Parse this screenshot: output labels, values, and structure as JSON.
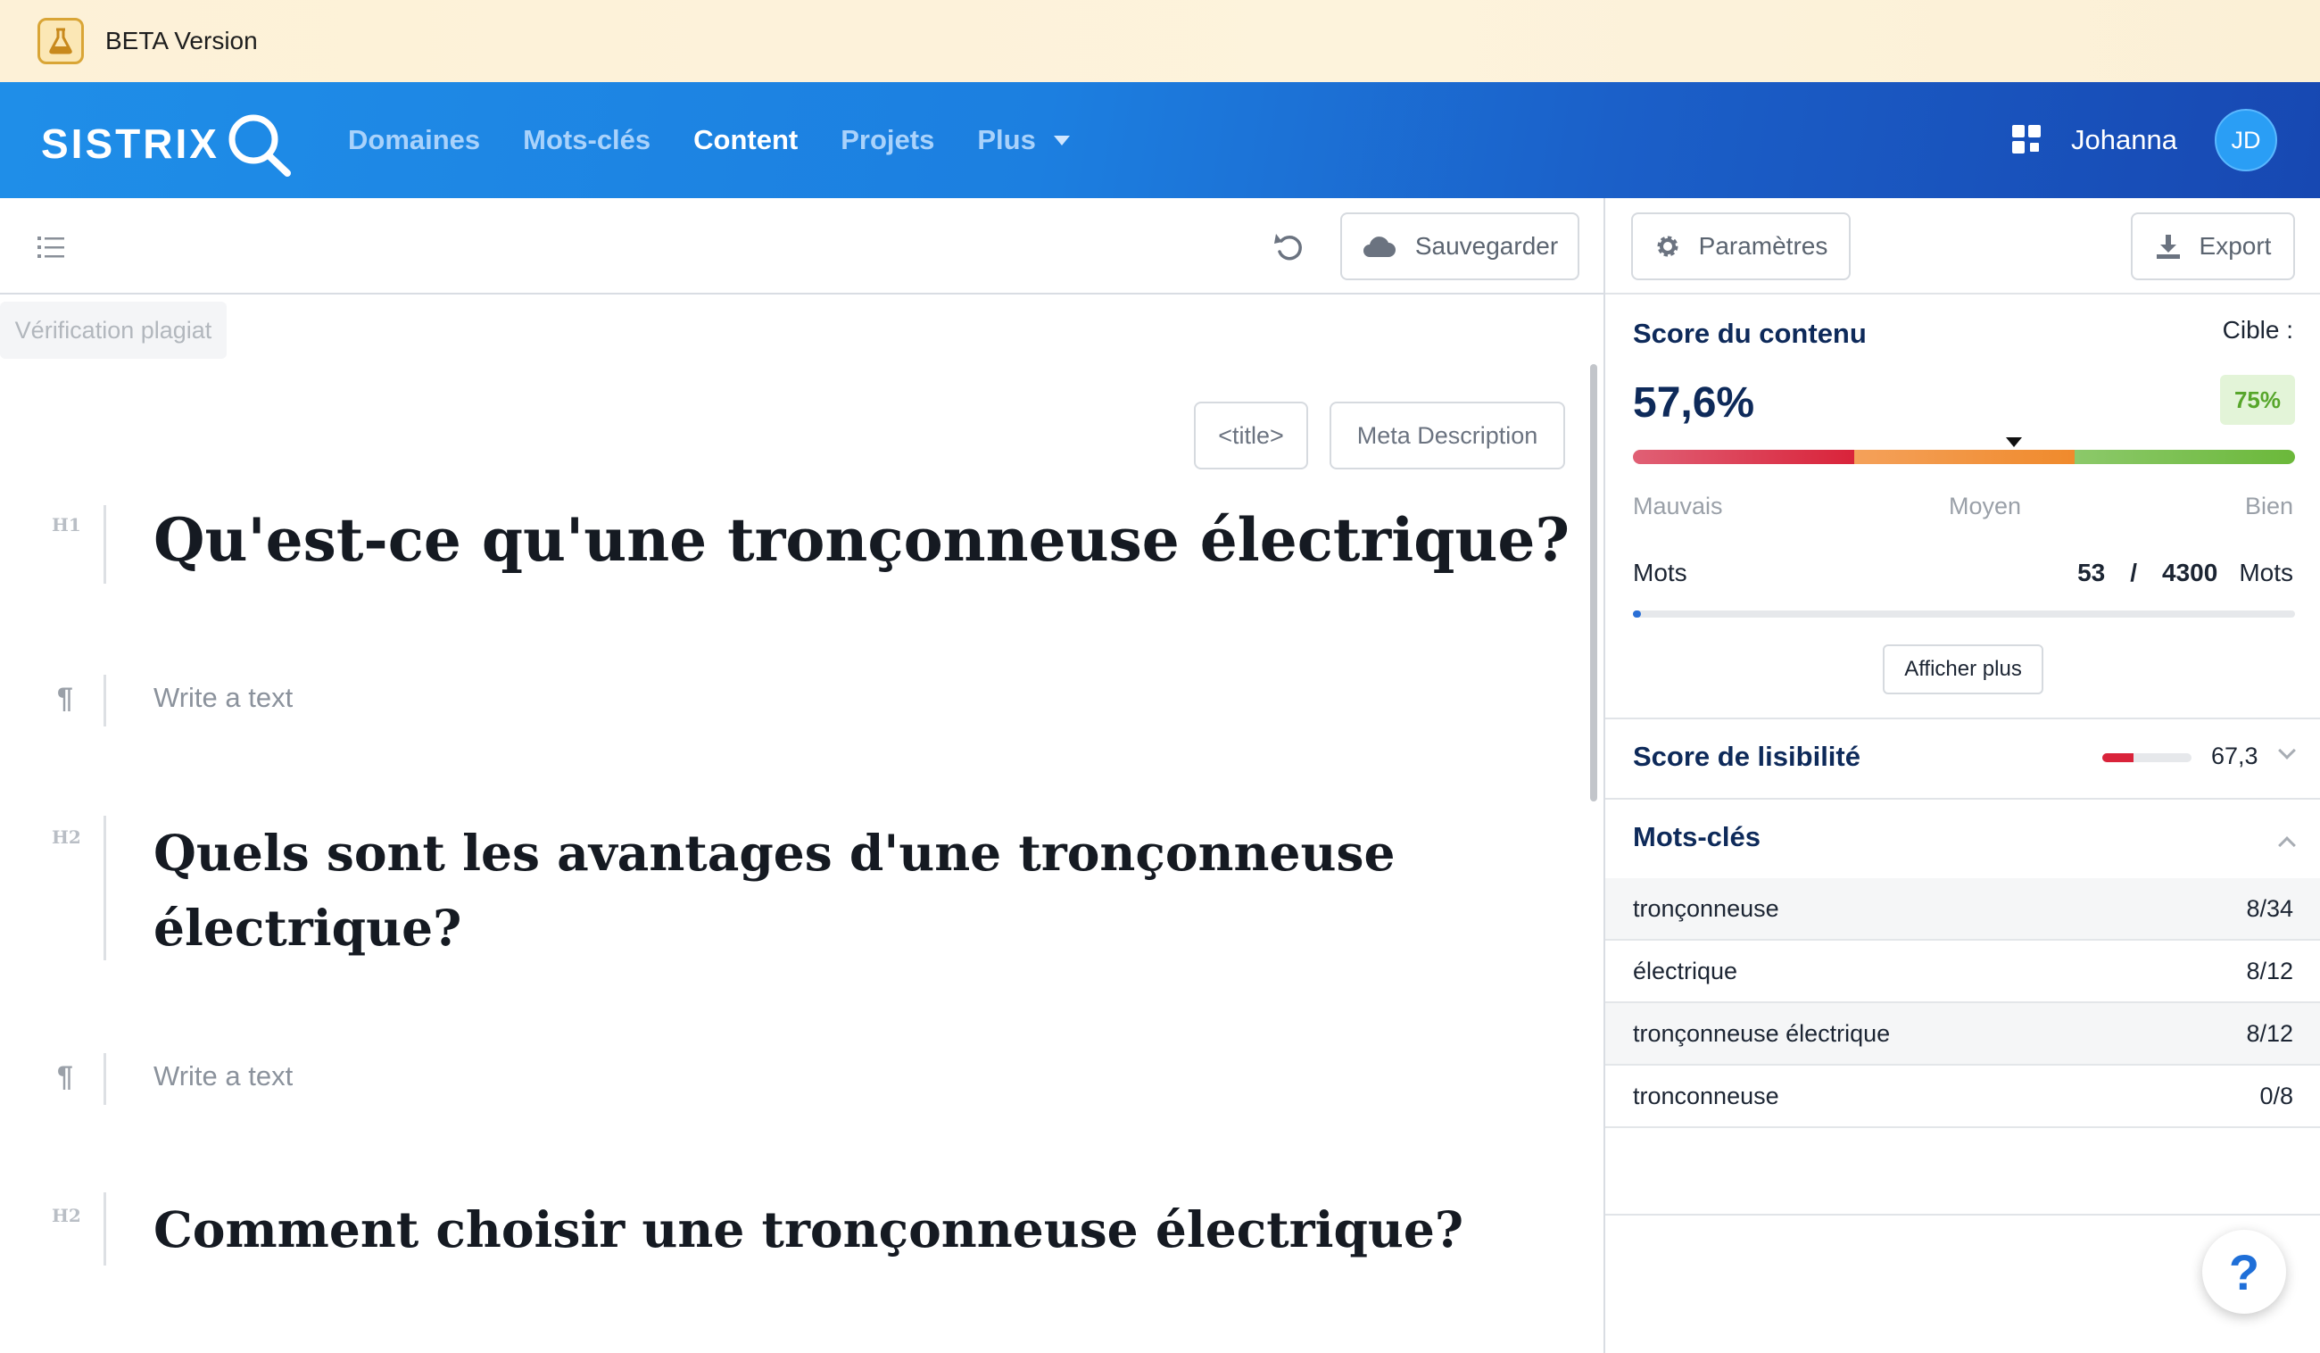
{
  "beta": {
    "label": "BETA Version"
  },
  "nav": {
    "logo": "SISTRIX",
    "links": [
      "Domaines",
      "Mots-clés",
      "Content",
      "Projets",
      "Plus"
    ],
    "active": "Content",
    "user_name": "Johanna",
    "avatar_initials": "JD"
  },
  "editor": {
    "save_label": "Sauvegarder",
    "plagiat_label": "Vérification plagiat",
    "title_btn": "<title>",
    "meta_btn": "Meta Description",
    "blocks": [
      {
        "type": "H1",
        "text": "Qu'est-ce qu'une tronçonneuse électrique?"
      },
      {
        "type": "p",
        "placeholder": "Write a text"
      },
      {
        "type": "H2",
        "line1": "Quels sont les avantages d'une tronçonneuse",
        "line2": "électrique?"
      },
      {
        "type": "p",
        "placeholder": "Write a text"
      },
      {
        "type": "H2",
        "text": "Comment choisir une tronçonneuse électrique?"
      }
    ]
  },
  "panel": {
    "params_label": "Paramètres",
    "export_label": "Export",
    "content_score": {
      "title": "Score du contenu",
      "target_label": "Cible :",
      "value": "57,6%",
      "target_value": "75%",
      "score_fraction": 0.576,
      "scale": [
        "Mauvais",
        "Moyen",
        "Bien"
      ],
      "colors": {
        "bad": "#d9233a",
        "medium": "#f08a2c",
        "good": "#6bb83a"
      }
    },
    "words": {
      "label": "Mots",
      "count": "53",
      "separator": "/",
      "target": "4300",
      "unit": "Mots",
      "fraction": 0.012
    },
    "show_more": "Afficher plus",
    "readability": {
      "title": "Score de lisibilité",
      "value": "67,3",
      "fraction": 0.35
    },
    "keywords": {
      "title": "Mots-clés",
      "items": [
        {
          "term": "tronçonneuse",
          "count": "8/34"
        },
        {
          "term": "électrique",
          "count": "8/12"
        },
        {
          "term": "tronçonneuse électrique",
          "count": "8/12"
        },
        {
          "term": "tronconneuse",
          "count": "0/8"
        }
      ]
    },
    "help": "?"
  }
}
